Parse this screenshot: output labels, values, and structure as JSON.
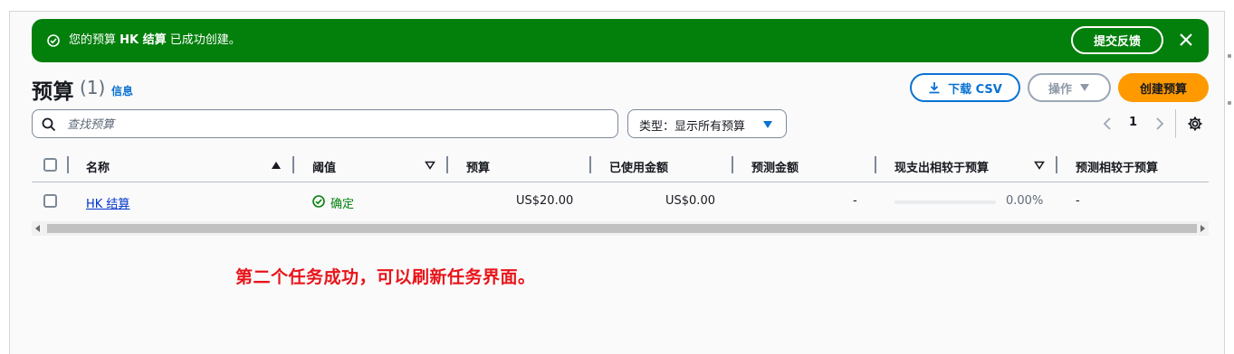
{
  "flash": {
    "message_prefix": "您的预算",
    "message_name": "HK 结算",
    "message_suffix": "已成功创建。",
    "feedback_button": "提交反馈",
    "color": "#037f0c"
  },
  "header": {
    "title": "预算",
    "count": "(1)",
    "info_link": "信息"
  },
  "toolbar": {
    "download_label": "下载 CSV",
    "actions_label": "操作",
    "create_label": "创建预算",
    "primary_color": "#ff9900",
    "link_color": "#0972d3"
  },
  "search": {
    "placeholder": "查找预算",
    "value": ""
  },
  "filter": {
    "label": "类型：显示所有预算"
  },
  "pagination": {
    "current_page": "1"
  },
  "table": {
    "columns": [
      "名称",
      "阈值",
      "预算",
      "已使用金额",
      "预测金额",
      "现支出相较于预算",
      "预测相较于预算"
    ],
    "rows": [
      {
        "name": "HK 结算",
        "threshold": "确定",
        "budget": "US$20.00",
        "used": "US$0.00",
        "forecast": "-",
        "actual_vs_budget": "0.00%",
        "actual_vs_budget_fraction": 0,
        "forecast_vs_budget": "-"
      }
    ]
  },
  "annotation": {
    "text": "第二个任务成功，可以刷新任务界面。",
    "color": "#e8141a"
  },
  "icons": {
    "flash_status": "check-circle-icon",
    "flash_close": "close-icon",
    "download": "download-icon",
    "actions_caret": "caret-down-icon",
    "search": "search-icon",
    "filter_caret": "caret-down-icon",
    "pager_prev": "chevron-left-icon",
    "pager_next": "chevron-right-icon",
    "settings": "gear-icon",
    "status_ok": "check-circle-icon"
  }
}
